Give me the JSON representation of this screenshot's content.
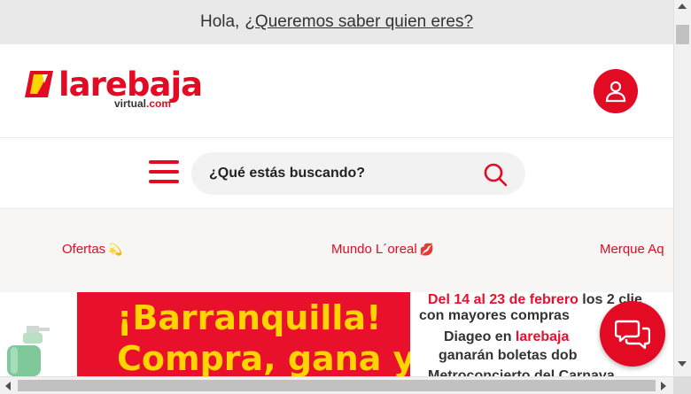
{
  "greeting": {
    "text": "Hola,",
    "link": "¿Queremos saber quien eres?"
  },
  "logo": {
    "brand": "larebaja",
    "sub": "virtual",
    "sub_suffix": ".com"
  },
  "search": {
    "placeholder": "¿Qué estás buscando?"
  },
  "categories": [
    {
      "label": "Ofertas",
      "emoji": "💫"
    },
    {
      "label": "Mundo L´oreal",
      "emoji": "💋"
    },
    {
      "label": "Merque Aq",
      "emoji": ""
    }
  ],
  "banner": {
    "headline_1": "¡Barranquilla!",
    "headline_2": "Compra, gana y",
    "l1_a": "Del 14 al 23 de febrero",
    "l1_b": " los 2 clie",
    "l2": "con mayores compras",
    "l3_a": "Diageo en ",
    "l3_b": "larebaja",
    "l4": "ganarán boletas dob",
    "l5": "Metroconcierto del Carnava"
  },
  "colors": {
    "brand_red": "#e30a23",
    "promo_yellow": "#ffd400",
    "topbar_bg": "#e9e9e9"
  },
  "icons": [
    "user-icon",
    "menu-icon",
    "search-icon",
    "chat-icon"
  ]
}
